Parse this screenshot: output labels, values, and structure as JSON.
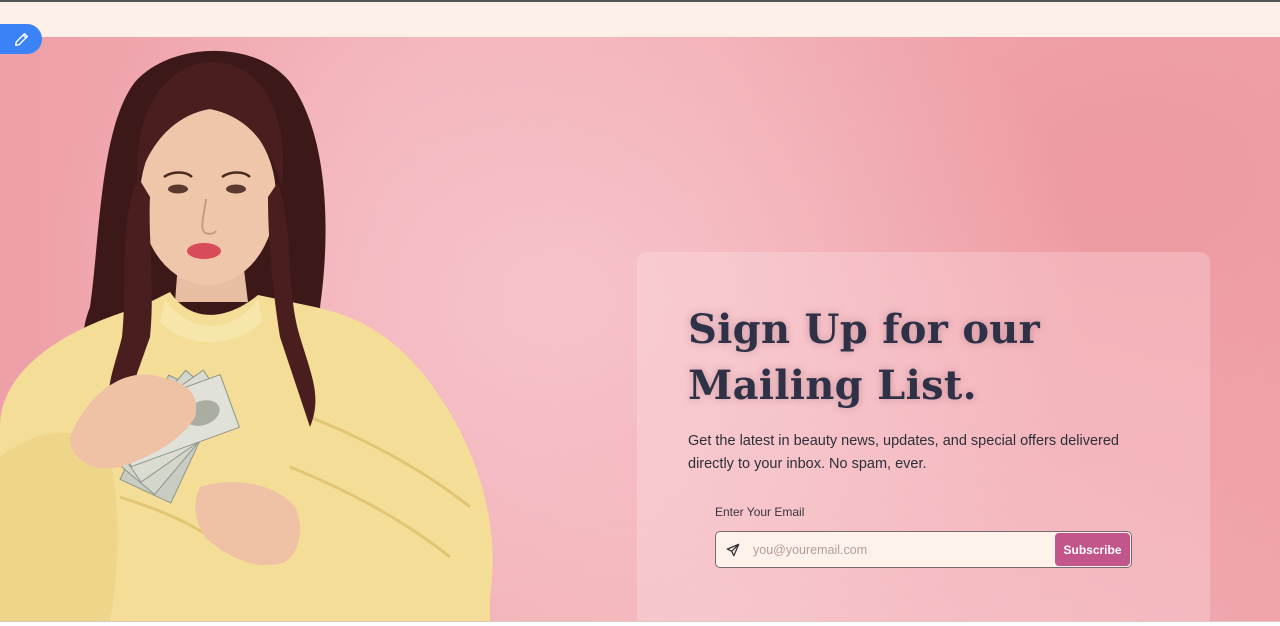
{
  "header": {
    "edit_icon": "pencil-icon",
    "edit_button_color": "#3b82f6"
  },
  "hero": {
    "image": "woman-holding-money-photo",
    "background_color": "#f2afb6"
  },
  "signup": {
    "title": "Sign Up for our Mailing List.",
    "description": "Get the latest in beauty news, updates, and special offers delivered directly to your inbox. No spam, ever.",
    "email_label": "Enter Your Email",
    "email_placeholder": "you@youremail.com",
    "email_value": "",
    "send_icon": "send-icon",
    "subscribe_label": "Subscribe",
    "subscribe_color": "#c2558a"
  }
}
